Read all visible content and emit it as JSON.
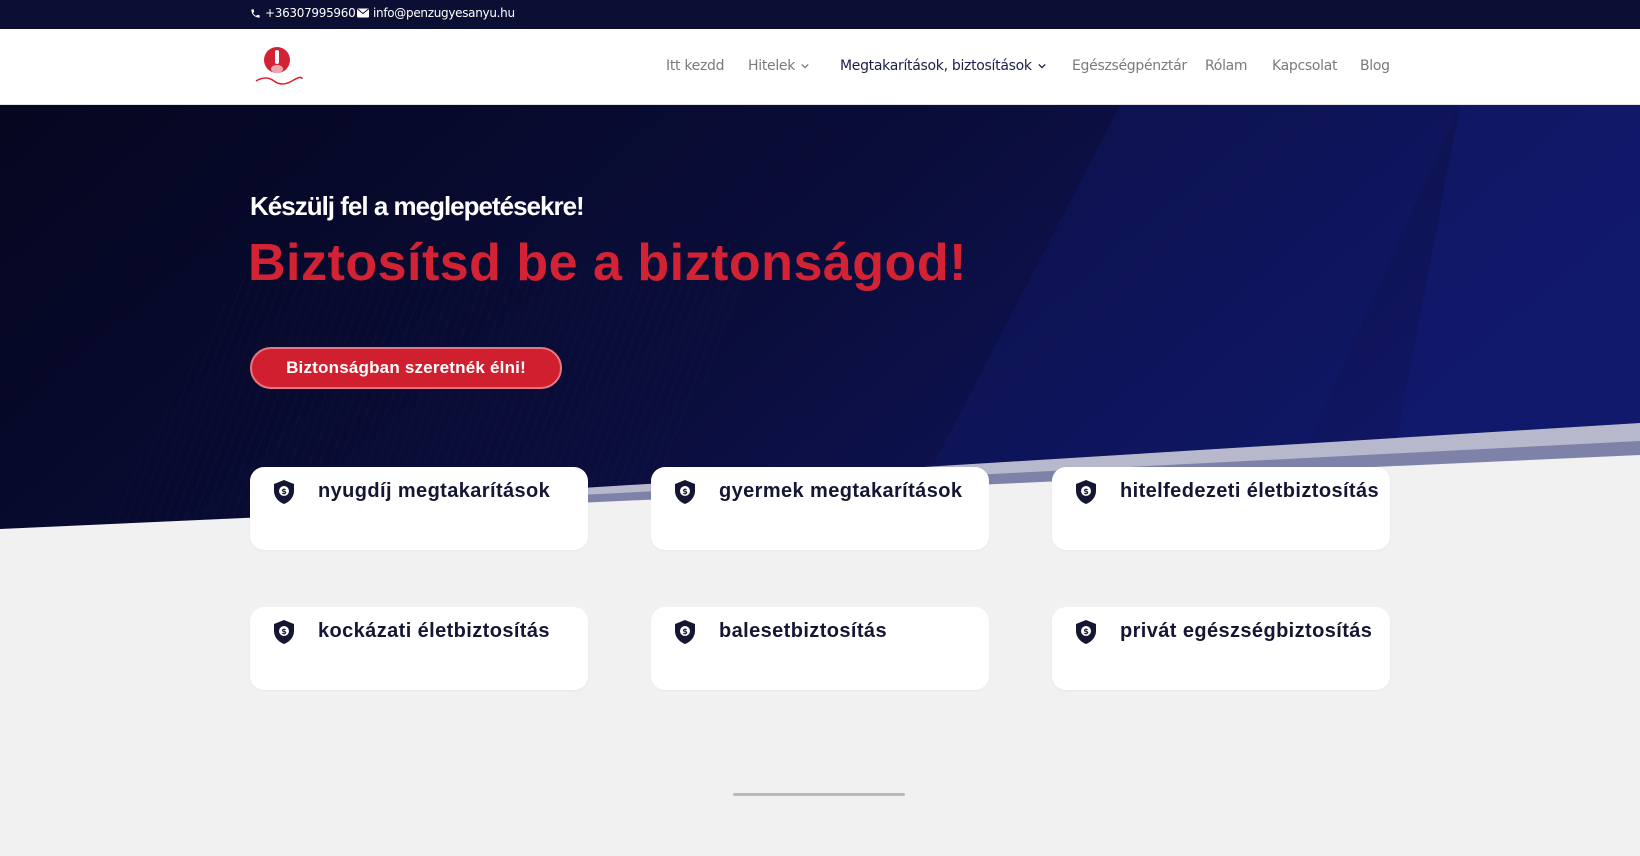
{
  "topbar": {
    "phone": "+36307995960",
    "email": "info@penzugyesanyu.hu"
  },
  "header": {
    "logo_icon": "red-bottle-logo",
    "nav": [
      {
        "label": "Itt kezdd",
        "has_dropdown": false
      },
      {
        "label": "Hitelek",
        "has_dropdown": true
      },
      {
        "label": "Megtakarítások, biztosítások",
        "has_dropdown": true,
        "active": true
      },
      {
        "label": "Egészségpénztár",
        "has_dropdown": false
      },
      {
        "label": "Rólam",
        "has_dropdown": false
      },
      {
        "label": "Kapcsolat",
        "has_dropdown": false
      },
      {
        "label": "Blog",
        "has_dropdown": false
      }
    ]
  },
  "hero": {
    "eyebrow": "Készülj fel a meglepetésekre!",
    "headline": "Biztosítsd be a biztonságod!",
    "cta_label": "Biztonságban szeretnék élni!"
  },
  "cards": [
    {
      "label": "nyugdíj megtakarítások",
      "icon": "shield-dollar-icon"
    },
    {
      "label": "gyermek megtakarítások",
      "icon": "shield-dollar-icon"
    },
    {
      "label": "hitelfedezeti életbiztosítás",
      "icon": "shield-dollar-icon"
    },
    {
      "label": "kockázati életbiztosítás",
      "icon": "shield-dollar-icon"
    },
    {
      "label": "balesetbiztosítás",
      "icon": "shield-dollar-icon"
    },
    {
      "label": "privát egészségbiztosítás",
      "icon": "shield-dollar-icon"
    }
  ],
  "colors": {
    "navy": "#0c0f33",
    "accent_red": "#d42235",
    "card_text": "#141633",
    "page_bg": "#f1f1f1"
  }
}
